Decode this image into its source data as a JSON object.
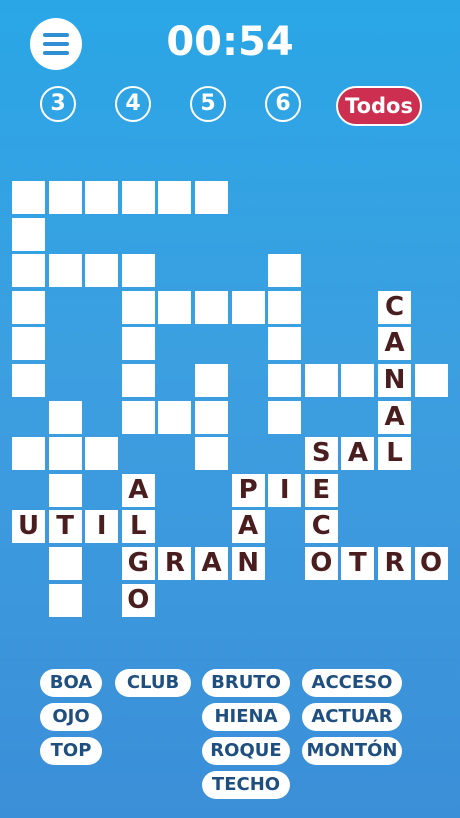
{
  "header": {
    "timer": "00:54"
  },
  "levels": [
    {
      "label": "3"
    },
    {
      "label": "4"
    },
    {
      "label": "5"
    },
    {
      "label": "6"
    },
    {
      "label": "Todos",
      "selected": true
    }
  ],
  "colors": {
    "background": "#3c9fe0",
    "selected_level": "#cc2f4f",
    "letter": "#4a1e1e",
    "word_text": "#1f4f7f"
  },
  "grid": {
    "cells": [
      {
        "c": 0,
        "r": 0,
        "l": ""
      },
      {
        "c": 1,
        "r": 0,
        "l": ""
      },
      {
        "c": 2,
        "r": 0,
        "l": ""
      },
      {
        "c": 3,
        "r": 0,
        "l": ""
      },
      {
        "c": 4,
        "r": 0,
        "l": ""
      },
      {
        "c": 5,
        "r": 0,
        "l": ""
      },
      {
        "c": 0,
        "r": 1,
        "l": ""
      },
      {
        "c": 0,
        "r": 2,
        "l": ""
      },
      {
        "c": 1,
        "r": 2,
        "l": ""
      },
      {
        "c": 2,
        "r": 2,
        "l": ""
      },
      {
        "c": 3,
        "r": 2,
        "l": ""
      },
      {
        "c": 7,
        "r": 2,
        "l": ""
      },
      {
        "c": 0,
        "r": 3,
        "l": ""
      },
      {
        "c": 3,
        "r": 3,
        "l": ""
      },
      {
        "c": 4,
        "r": 3,
        "l": ""
      },
      {
        "c": 5,
        "r": 3,
        "l": ""
      },
      {
        "c": 6,
        "r": 3,
        "l": ""
      },
      {
        "c": 7,
        "r": 3,
        "l": ""
      },
      {
        "c": 10,
        "r": 3,
        "l": "C"
      },
      {
        "c": 0,
        "r": 4,
        "l": ""
      },
      {
        "c": 3,
        "r": 4,
        "l": ""
      },
      {
        "c": 7,
        "r": 4,
        "l": ""
      },
      {
        "c": 10,
        "r": 4,
        "l": "A"
      },
      {
        "c": 0,
        "r": 5,
        "l": ""
      },
      {
        "c": 3,
        "r": 5,
        "l": ""
      },
      {
        "c": 5,
        "r": 5,
        "l": ""
      },
      {
        "c": 7,
        "r": 5,
        "l": ""
      },
      {
        "c": 8,
        "r": 5,
        "l": ""
      },
      {
        "c": 9,
        "r": 5,
        "l": ""
      },
      {
        "c": 10,
        "r": 5,
        "l": "N"
      },
      {
        "c": 11,
        "r": 5,
        "l": ""
      },
      {
        "c": 1,
        "r": 6,
        "l": ""
      },
      {
        "c": 3,
        "r": 6,
        "l": ""
      },
      {
        "c": 4,
        "r": 6,
        "l": ""
      },
      {
        "c": 5,
        "r": 6,
        "l": ""
      },
      {
        "c": 7,
        "r": 6,
        "l": ""
      },
      {
        "c": 10,
        "r": 6,
        "l": "A"
      },
      {
        "c": 0,
        "r": 7,
        "l": ""
      },
      {
        "c": 1,
        "r": 7,
        "l": ""
      },
      {
        "c": 2,
        "r": 7,
        "l": ""
      },
      {
        "c": 5,
        "r": 7,
        "l": ""
      },
      {
        "c": 8,
        "r": 7,
        "l": "S"
      },
      {
        "c": 9,
        "r": 7,
        "l": "A"
      },
      {
        "c": 10,
        "r": 7,
        "l": "L"
      },
      {
        "c": 1,
        "r": 8,
        "l": ""
      },
      {
        "c": 3,
        "r": 8,
        "l": "A"
      },
      {
        "c": 6,
        "r": 8,
        "l": "P"
      },
      {
        "c": 7,
        "r": 8,
        "l": "I"
      },
      {
        "c": 8,
        "r": 8,
        "l": "E"
      },
      {
        "c": 0,
        "r": 9,
        "l": "U"
      },
      {
        "c": 1,
        "r": 9,
        "l": "T"
      },
      {
        "c": 2,
        "r": 9,
        "l": "I"
      },
      {
        "c": 3,
        "r": 9,
        "l": "L"
      },
      {
        "c": 6,
        "r": 9,
        "l": "A"
      },
      {
        "c": 8,
        "r": 9,
        "l": "C"
      },
      {
        "c": 1,
        "r": 10,
        "l": ""
      },
      {
        "c": 3,
        "r": 10,
        "l": "G"
      },
      {
        "c": 4,
        "r": 10,
        "l": "R"
      },
      {
        "c": 5,
        "r": 10,
        "l": "A"
      },
      {
        "c": 6,
        "r": 10,
        "l": "N"
      },
      {
        "c": 8,
        "r": 10,
        "l": "O"
      },
      {
        "c": 9,
        "r": 10,
        "l": "T"
      },
      {
        "c": 10,
        "r": 10,
        "l": "R"
      },
      {
        "c": 11,
        "r": 10,
        "l": "O"
      },
      {
        "c": 1,
        "r": 11,
        "l": ""
      },
      {
        "c": 3,
        "r": 11,
        "l": "O"
      }
    ]
  },
  "words": [
    {
      "text": "BOA",
      "col": 0,
      "row": 0
    },
    {
      "text": "CLUB",
      "col": 1,
      "row": 0
    },
    {
      "text": "BRUTO",
      "col": 2,
      "row": 0
    },
    {
      "text": "ACCESO",
      "col": 3,
      "row": 0
    },
    {
      "text": "OJO",
      "col": 0,
      "row": 1
    },
    {
      "text": "HIENA",
      "col": 2,
      "row": 1
    },
    {
      "text": "ACTUAR",
      "col": 3,
      "row": 1
    },
    {
      "text": "TOP",
      "col": 0,
      "row": 2
    },
    {
      "text": "ROQUE",
      "col": 2,
      "row": 2
    },
    {
      "text": "MONTÓN",
      "col": 3,
      "row": 2
    },
    {
      "text": "TECHO",
      "col": 2,
      "row": 3
    }
  ]
}
